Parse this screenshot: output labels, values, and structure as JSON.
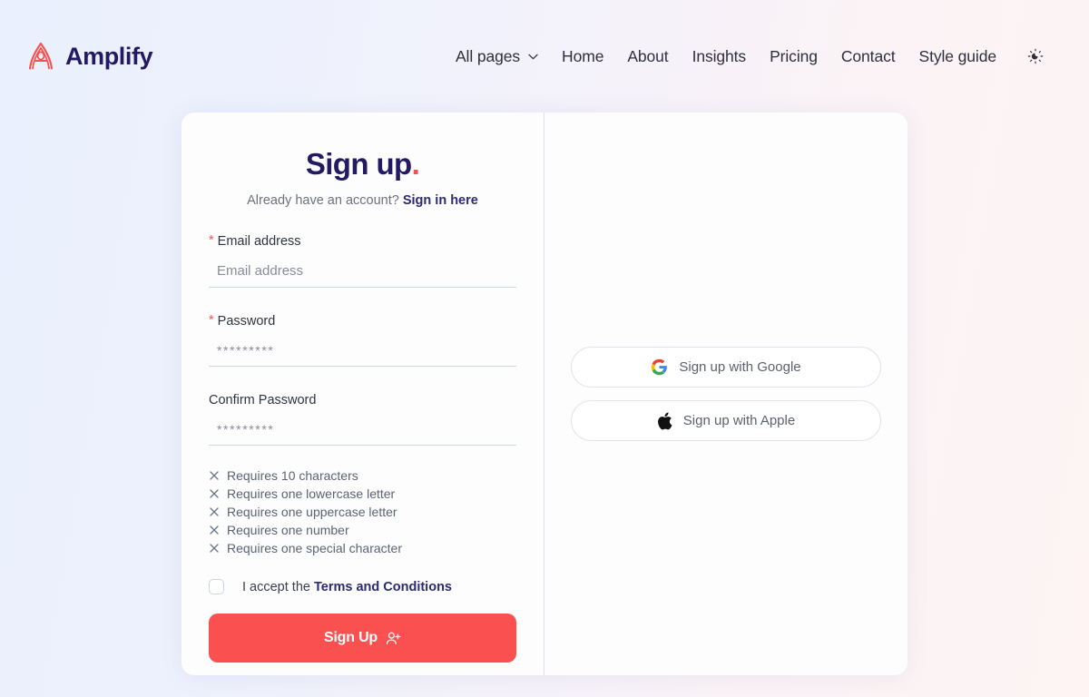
{
  "brand": {
    "name": "Amplify",
    "logo_icon": "amplify-a-logo-icon",
    "logo_color": "#fb4f4f",
    "text_color": "#231a63"
  },
  "nav": {
    "dropdown": {
      "label": "All pages",
      "icon": "chevron-down-icon"
    },
    "links": [
      {
        "label": "Home"
      },
      {
        "label": "About"
      },
      {
        "label": "Insights"
      },
      {
        "label": "Pricing"
      },
      {
        "label": "Contact"
      },
      {
        "label": "Style guide"
      }
    ],
    "theme_toggle_icon": "sun-moon-toggle-icon"
  },
  "signup": {
    "title": "Sign up",
    "title_punct": ".",
    "subtitle_prefix": "Already have an account?",
    "signin_link": "Sign in here",
    "fields": [
      {
        "label": "Email address",
        "required": true,
        "required_mark": "*",
        "placeholder": "Email address",
        "value": "",
        "type": "email",
        "name": "email-field"
      },
      {
        "label": "Password",
        "required": true,
        "required_mark": "*",
        "placeholder": "*********",
        "value": "",
        "type": "password",
        "name": "password-field"
      },
      {
        "label": "Confirm Password",
        "required": false,
        "required_mark": "",
        "placeholder": "*********",
        "value": "",
        "type": "password",
        "name": "confirm-password-field"
      }
    ],
    "requirements": [
      {
        "text": "Requires 10 characters",
        "met": false,
        "icon": "x-icon"
      },
      {
        "text": "Requires one lowercase letter",
        "met": false,
        "icon": "x-icon"
      },
      {
        "text": "Requires one uppercase letter",
        "met": false,
        "icon": "x-icon"
      },
      {
        "text": "Requires one number",
        "met": false,
        "icon": "x-icon"
      },
      {
        "text": "Requires one special character",
        "met": false,
        "icon": "x-icon"
      }
    ],
    "terms": {
      "checked": false,
      "prefix": "I accept the",
      "link": "Terms and Conditions"
    },
    "submit": {
      "label": "Sign Up",
      "icon": "user-plus-icon",
      "color": "#fb5050"
    }
  },
  "social": {
    "buttons": [
      {
        "label": "Sign up with Google",
        "icon": "google-icon"
      },
      {
        "label": "Sign up with Apple",
        "icon": "apple-icon"
      }
    ]
  },
  "colors": {
    "accent_red": "#fb4f4f",
    "navy": "#231a63",
    "bg_gradient_start": "#eaf0fd",
    "bg_gradient_end": "#fdf4f3",
    "card_bg": "#fdfdfe",
    "underline": "#ccd8e8"
  }
}
